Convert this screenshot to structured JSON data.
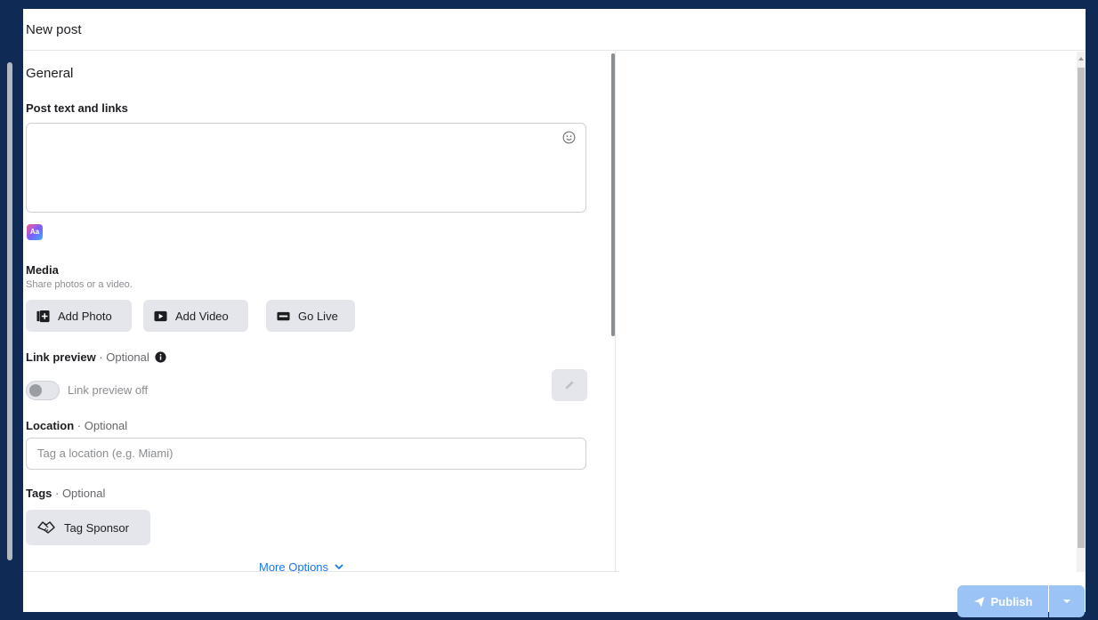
{
  "dialog": {
    "title": "New post"
  },
  "general": {
    "heading": "General",
    "post_text_label": "Post text and links",
    "post_text_value": ""
  },
  "media": {
    "label": "Media",
    "sublabel": "Share photos or a video.",
    "buttons": [
      {
        "label": "Add Photo",
        "icon": "add-photo-icon"
      },
      {
        "label": "Add Video",
        "icon": "video-icon"
      },
      {
        "label": "Go Live",
        "icon": "live-icon"
      }
    ]
  },
  "link_preview": {
    "label": "Link preview",
    "optional": " · Optional",
    "toggle_label": "Link preview off",
    "toggle_on": false
  },
  "location": {
    "label": "Location",
    "optional": " · Optional",
    "placeholder": "Tag a location (e.g. Miami)",
    "value": ""
  },
  "tags": {
    "label": "Tags",
    "optional": " · Optional",
    "button_label": "Tag Sponsor"
  },
  "more_options": "More Options",
  "footer": {
    "publish_label": "Publish"
  },
  "colors": {
    "accent": "#1877f2",
    "publish_disabled": "#9cc3f5",
    "frame": "#0f2a55"
  }
}
